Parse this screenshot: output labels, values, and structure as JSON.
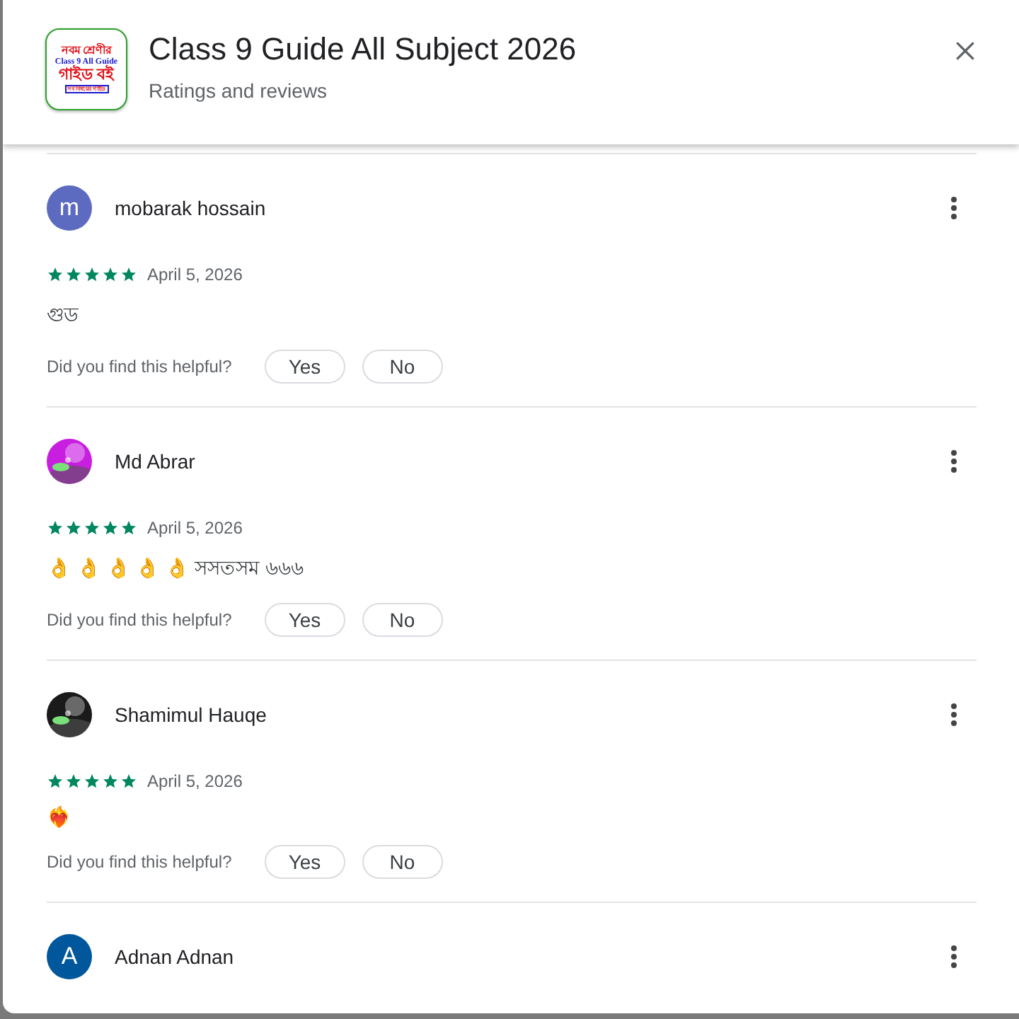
{
  "app": {
    "logo_lines": [
      "নবম শ্রেণীর",
      "Class 9 All Guide",
      "গাইড বই",
      "সব বিষয়ের গাইড"
    ],
    "title": "Class 9 Guide All Subject 2026",
    "subtitle": "Ratings and reviews"
  },
  "reviews": [
    {
      "name": "mobarak hossain",
      "avatar": {
        "kind": "letter",
        "letter": "m",
        "color": "#5c6bc0"
      },
      "stars": 5,
      "date": "April 5, 2026",
      "text": "গুড",
      "helpful_prompt": "Did you find this helpful?",
      "buttons": [
        "Yes",
        "No"
      ]
    },
    {
      "name": "Md Abrar",
      "stars": 5,
      "date": "April 5, 2026",
      "text": "👌 👌 👌 👌 👌 সসতসম ৬৬৬",
      "helpful_prompt": "Did you find this helpful?",
      "buttons": [
        "Yes",
        "No"
      ]
    },
    {
      "name": "Shamimul Hauqe",
      "stars": 5,
      "date": "April 5, 2026",
      "text": "❤️‍🔥",
      "helpful_prompt": "Did you find this helpful?",
      "buttons": [
        "Yes",
        "No"
      ]
    },
    {
      "name": "Adnan Adnan",
      "avatar": {
        "kind": "letter",
        "letter": "A",
        "color": "#01579b"
      }
    }
  ]
}
